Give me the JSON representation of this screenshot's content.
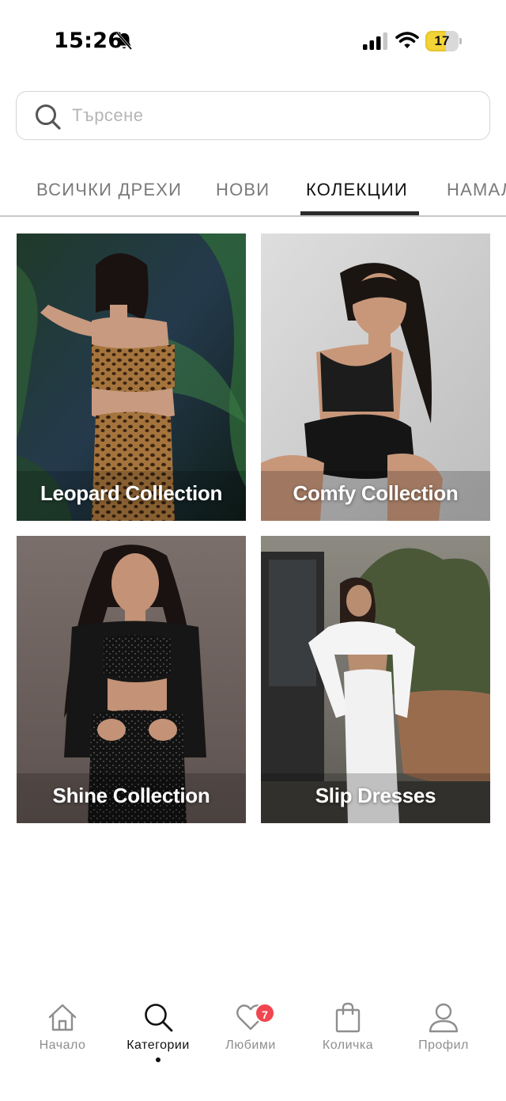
{
  "status_bar": {
    "time": "15:26",
    "battery": "17",
    "icons": [
      "bell-muted-icon",
      "cellular-signal-icon",
      "wifi-icon",
      "battery-icon"
    ]
  },
  "search": {
    "placeholder": "Търсене",
    "value": ""
  },
  "tabs": [
    {
      "label": "ВСИЧКИ ДРЕХИ",
      "active": false
    },
    {
      "label": "НОВИ",
      "active": false
    },
    {
      "label": "КОЛЕКЦИИ",
      "active": true
    },
    {
      "label": "НАМАЛЕНИЯ",
      "active": false
    }
  ],
  "collections": [
    {
      "title": "Leopard Collection"
    },
    {
      "title": "Comfy Collection"
    },
    {
      "title": "Shine Collection"
    },
    {
      "title": "Slip Dresses"
    }
  ],
  "bottom_nav": {
    "items": [
      {
        "label": "Начало",
        "icon": "home-icon",
        "active": false
      },
      {
        "label": "Категории",
        "icon": "search-icon",
        "active": true
      },
      {
        "label": "Любими",
        "icon": "heart-icon",
        "active": false,
        "badge": "7"
      },
      {
        "label": "Количка",
        "icon": "shopping-bag-icon",
        "active": false
      },
      {
        "label": "Профил",
        "icon": "profile-icon",
        "active": false
      }
    ]
  },
  "colors": {
    "active_tab": "#111111",
    "inactive_tab": "#7a7a7a",
    "badge": "#f1464f",
    "battery": "#f2d338"
  }
}
